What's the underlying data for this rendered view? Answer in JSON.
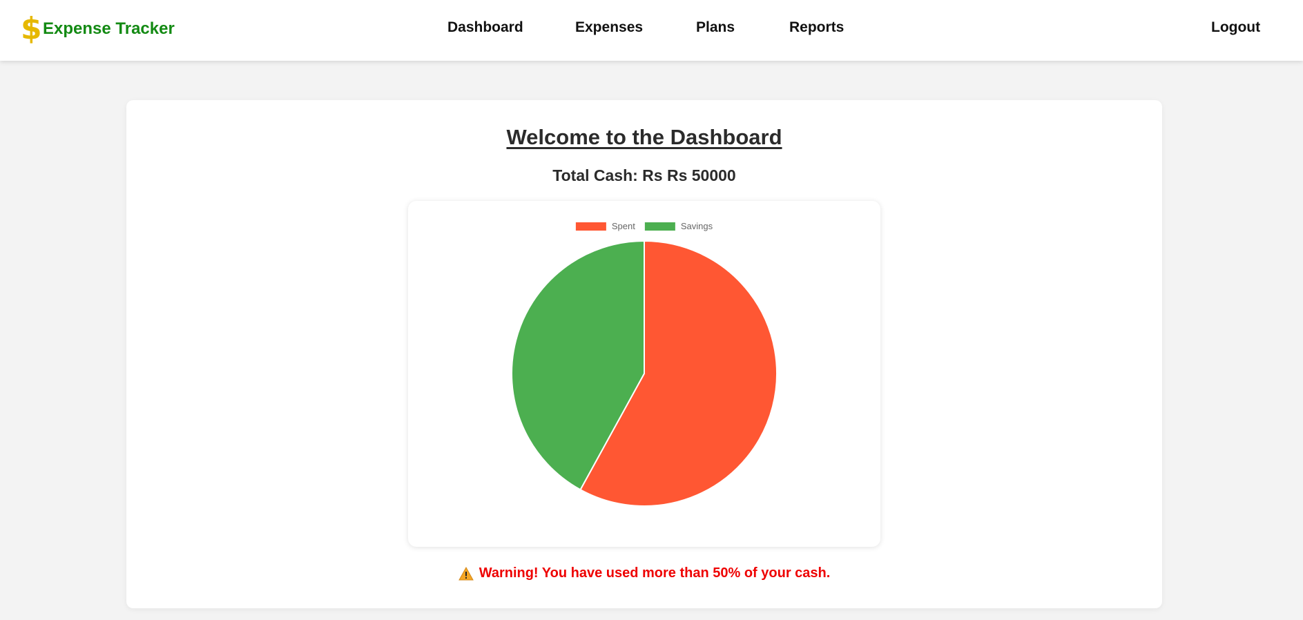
{
  "brand": {
    "icon_name": "dollar-icon",
    "icon_glyph": "$",
    "icon_color": "#e6b800",
    "name": "Expense Tracker",
    "color": "#138a13"
  },
  "nav": {
    "links": [
      {
        "label": "Dashboard"
      },
      {
        "label": "Expenses"
      },
      {
        "label": "Plans"
      },
      {
        "label": "Reports"
      }
    ],
    "logout_label": "Logout"
  },
  "dashboard": {
    "title": "Welcome to the Dashboard",
    "total_cash": "Total Cash: Rs Rs 50000"
  },
  "chart_data": {
    "type": "pie",
    "title": "",
    "legend_position": "top",
    "series": [
      {
        "name": "Spent",
        "value": 58,
        "color": "#ff5733"
      },
      {
        "name": "Savings",
        "value": 42,
        "color": "#4caf50"
      }
    ]
  },
  "warning": {
    "icon_name": "warning-icon",
    "text": "Warning! You have used more than 50% of your cash.",
    "color": "#ee0000"
  }
}
